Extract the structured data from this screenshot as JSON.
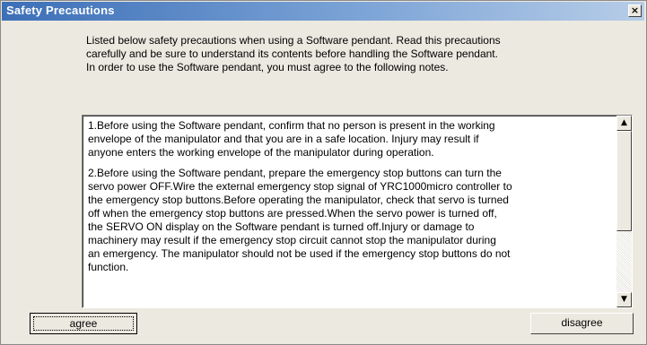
{
  "window": {
    "title": "Safety Precautions",
    "close_label": "×"
  },
  "intro": {
    "lines": [
      "Listed below safety precautions when using a Software pendant. Read this precautions",
      "carefully and be sure to understand its contents before handling the Software pendant.",
      "In order to use the Software pendant, you must agree to the following notes."
    ]
  },
  "notes": {
    "paragraphs": [
      [
        "1.Before using the Software pendant, confirm that no person is present in the working",
        "envelope of the manipulator and that you are in a safe location. Injury may result if",
        "anyone enters the working envelope of the manipulator during operation."
      ],
      [
        "2.Before using the Software pendant, prepare the emergency stop buttons can turn the",
        "servo power OFF.Wire the external emergency stop signal of YRC1000micro controller to",
        "the emergency stop buttons.Before operating the manipulator, check that servo is turned",
        "off when the emergency stop buttons are pressed.When the servo power is turned off,",
        "the SERVO ON display on the Software pendant is turned off.Injury or damage to",
        "machinery may result if the emergency stop circuit cannot stop the manipulator during",
        "an emergency. The manipulator should not be used if the emergency stop buttons do not",
        "function."
      ]
    ]
  },
  "scrollbar": {
    "up_arrow": "▲",
    "down_arrow": "▼"
  },
  "buttons": {
    "agree_label": "agree",
    "disagree_label": "disagree"
  }
}
